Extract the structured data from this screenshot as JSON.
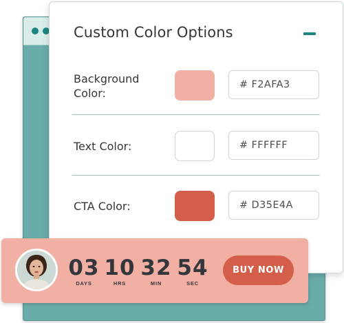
{
  "panel": {
    "title": "Custom Color Options",
    "collapse_icon": "minus-icon"
  },
  "colors": {
    "accent": "#1F8580",
    "back_window": "#6AACA9"
  },
  "rows": [
    {
      "label": "Background\nColor:",
      "hex_value": "# F2AFA3",
      "swatch_color": "#F2AFA3"
    },
    {
      "label": "Text Color:",
      "hex_value": "# FFFFFF",
      "swatch_color": "#FFFFFF"
    },
    {
      "label": "CTA Color:",
      "hex_value": "# D35E4A",
      "swatch_color": "#D35E4A"
    }
  ],
  "countdown": {
    "avatar_icon": "user-avatar",
    "timer": [
      {
        "value": "03",
        "unit": "DAYS"
      },
      {
        "value": "10",
        "unit": "HRS"
      },
      {
        "value": "32",
        "unit": "MIN"
      },
      {
        "value": "54",
        "unit": "SEC"
      }
    ],
    "buy_label": "BUY NOW"
  }
}
